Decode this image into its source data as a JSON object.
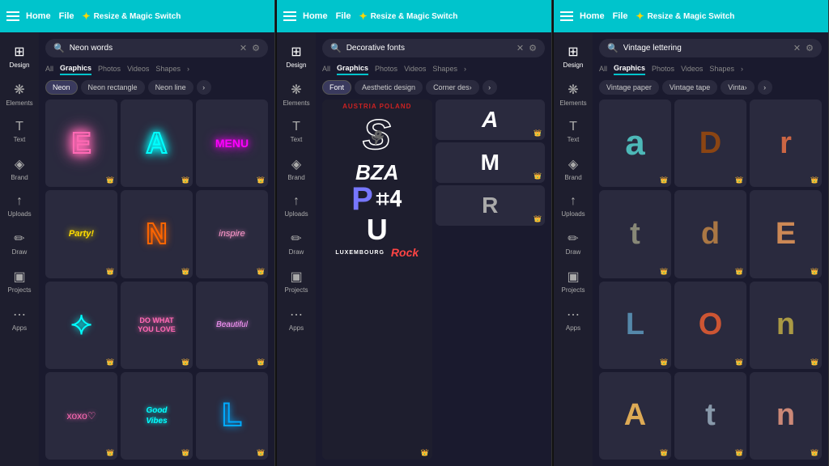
{
  "panels": [
    {
      "id": "neon",
      "topbar": {
        "home": "Home",
        "file": "File",
        "resize": "Resize & Magic Switch"
      },
      "search": {
        "value": "Neon words",
        "placeholder": "Neon words"
      },
      "tabs": [
        "All",
        "Graphics",
        "Photos",
        "Videos",
        "Shapes"
      ],
      "active_tab": "Graphics",
      "chips": [
        "Neon",
        "Neon rectangle",
        "Neon line"
      ],
      "active_chip": "Neon",
      "sidebar_items": [
        "Design",
        "Elements",
        "Text",
        "Brand",
        "Uploads",
        "Draw",
        "Projects",
        "Apps"
      ]
    },
    {
      "id": "font",
      "topbar": {
        "home": "Home",
        "file": "File",
        "resize": "Resize & Magic Switch"
      },
      "search": {
        "value": "Decorative fonts",
        "placeholder": "Decorative fonts"
      },
      "tabs": [
        "All",
        "Graphics",
        "Photos",
        "Videos",
        "Shapes"
      ],
      "active_tab": "Graphics",
      "chips": [
        "Font",
        "Aesthetic design",
        "Corner des..."
      ],
      "active_chip": "Font",
      "sidebar_items": [
        "Design",
        "Elements",
        "Text",
        "Brand",
        "Uploads",
        "Draw",
        "Projects",
        "Apps"
      ]
    },
    {
      "id": "vintage",
      "topbar": {
        "home": "Home",
        "file": "File",
        "resize": "Resize & Magic Switch"
      },
      "search": {
        "value": "Vintage lettering",
        "placeholder": "Vintage lettering"
      },
      "tabs": [
        "All",
        "Graphics",
        "Photos",
        "Videos",
        "Shapes"
      ],
      "active_tab": "Graphics",
      "chips": [
        "Vintage paper",
        "Vintage tape",
        "Vinta..."
      ],
      "active_chip": "Graphics",
      "sidebar_items": [
        "Design",
        "Elements",
        "Text",
        "Brand",
        "Uploads",
        "Draw",
        "Projects",
        "Apps"
      ]
    }
  ]
}
